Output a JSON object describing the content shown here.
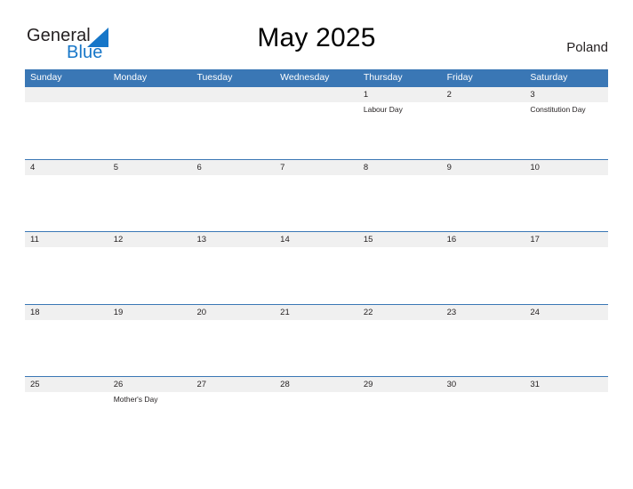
{
  "brand": {
    "name_part1": "General",
    "name_part2": "Blue",
    "triangle_color": "#1676c8",
    "text_color": "#231f20",
    "blue_color": "#1676c8"
  },
  "header": {
    "title": "May 2025",
    "country": "Poland"
  },
  "theme": {
    "header_blue": "#3a77b5",
    "band_gray": "#f0f0f0",
    "text_dark": "#231f20",
    "background": "#ffffff"
  },
  "calendar": {
    "weekday_headers": [
      "Sunday",
      "Monday",
      "Tuesday",
      "Wednesday",
      "Thursday",
      "Friday",
      "Saturday"
    ],
    "weeks": [
      {
        "days": [
          {
            "num": "",
            "event": ""
          },
          {
            "num": "",
            "event": ""
          },
          {
            "num": "",
            "event": ""
          },
          {
            "num": "",
            "event": ""
          },
          {
            "num": "1",
            "event": "Labour Day"
          },
          {
            "num": "2",
            "event": ""
          },
          {
            "num": "3",
            "event": "Constitution Day"
          }
        ]
      },
      {
        "days": [
          {
            "num": "4",
            "event": ""
          },
          {
            "num": "5",
            "event": ""
          },
          {
            "num": "6",
            "event": ""
          },
          {
            "num": "7",
            "event": ""
          },
          {
            "num": "8",
            "event": ""
          },
          {
            "num": "9",
            "event": ""
          },
          {
            "num": "10",
            "event": ""
          }
        ]
      },
      {
        "days": [
          {
            "num": "11",
            "event": ""
          },
          {
            "num": "12",
            "event": ""
          },
          {
            "num": "13",
            "event": ""
          },
          {
            "num": "14",
            "event": ""
          },
          {
            "num": "15",
            "event": ""
          },
          {
            "num": "16",
            "event": ""
          },
          {
            "num": "17",
            "event": ""
          }
        ]
      },
      {
        "days": [
          {
            "num": "18",
            "event": ""
          },
          {
            "num": "19",
            "event": ""
          },
          {
            "num": "20",
            "event": ""
          },
          {
            "num": "21",
            "event": ""
          },
          {
            "num": "22",
            "event": ""
          },
          {
            "num": "23",
            "event": ""
          },
          {
            "num": "24",
            "event": ""
          }
        ]
      },
      {
        "days": [
          {
            "num": "25",
            "event": ""
          },
          {
            "num": "26",
            "event": "Mother's Day"
          },
          {
            "num": "27",
            "event": ""
          },
          {
            "num": "28",
            "event": ""
          },
          {
            "num": "29",
            "event": ""
          },
          {
            "num": "30",
            "event": ""
          },
          {
            "num": "31",
            "event": ""
          }
        ]
      }
    ]
  }
}
